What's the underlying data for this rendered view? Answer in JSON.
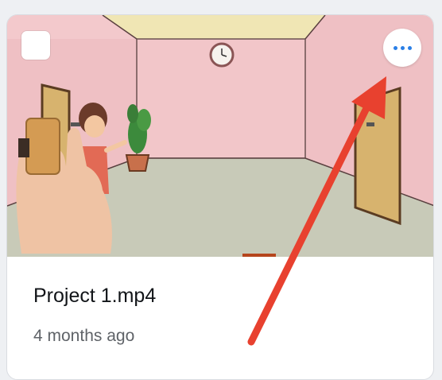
{
  "card": {
    "title": "Project 1.mp4",
    "modified": "4 months ago"
  },
  "controls": {
    "checkbox_checked": false,
    "more_icon": "more-horizontal-icon"
  },
  "colors": {
    "accent": "#2a7fe6",
    "annotation_arrow": "#e8412f",
    "wall": "#f1c4c6",
    "floor": "#c9cbb9",
    "ceiling": "#f0e6b6"
  }
}
